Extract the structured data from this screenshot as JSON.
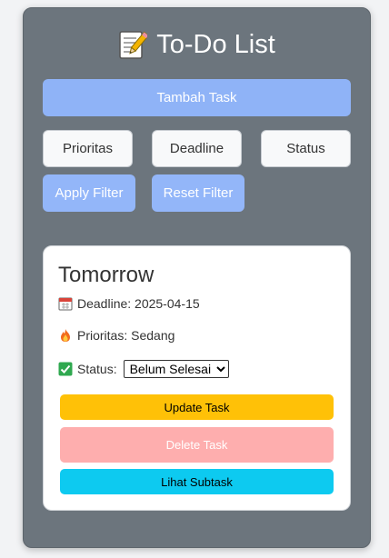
{
  "app": {
    "title": "To-Do List",
    "title_icon": "memo-icon"
  },
  "toolbar": {
    "add_label": "Tambah Task",
    "filters": [
      {
        "label": "Prioritas"
      },
      {
        "label": "Deadline"
      },
      {
        "label": "Status"
      }
    ],
    "apply_label": "Apply Filter",
    "reset_label": "Reset Filter"
  },
  "task": {
    "title": "Tomorrow",
    "deadline_text": "Deadline: 2025-04-15",
    "priority_text": "Prioritas: Sedang",
    "status_label": "Status:",
    "status_value": "Belum Selesai",
    "update_label": "Update Task",
    "delete_label": "Delete Task",
    "subtask_label": "Lihat Subtask"
  },
  "colors": {
    "panel": "#6c757d",
    "primary_soft": "#8fb3f7",
    "update": "#ffc107",
    "delete": "#feaeae",
    "subtask": "#0dcaf0"
  }
}
